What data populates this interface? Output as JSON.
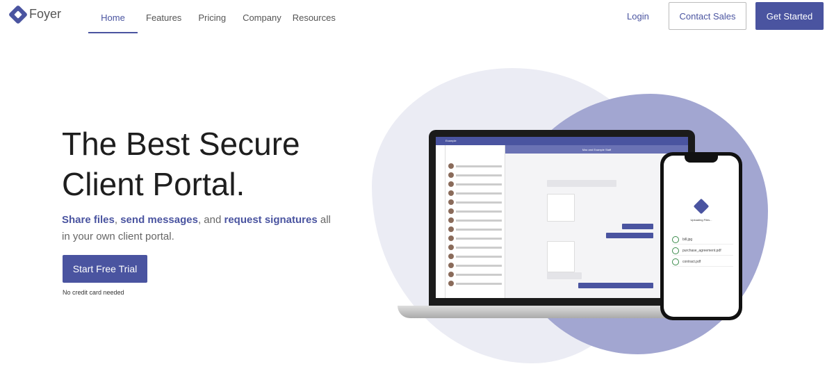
{
  "nav": {
    "logo": "Foyer",
    "links": [
      "Home",
      "Features",
      "Pricing",
      "Company",
      "Resources"
    ],
    "active": "Home",
    "login": "Login",
    "contact_sales": "Contact Sales",
    "get_started": "Get Started"
  },
  "hero": {
    "title_line1": "The Best Secure",
    "title_line2": "Client Portal.",
    "sub": {
      "b1": "Share files",
      "t1": ", ",
      "b2": "send messages",
      "t2": ", and ",
      "b3": "request signatures",
      "t3": " all in your own client portal."
    },
    "cta": "Start Free Trial",
    "note": "No credit card needed"
  },
  "mockup": {
    "app_title": "Example",
    "chat_title": "Max and Example Staff",
    "phone_title": "Uploading Files...",
    "files": [
      "bill.jpg",
      "purchase_agreement.pdf",
      "contract.pdf"
    ]
  },
  "colors": {
    "accent": "#4a54a0",
    "blob_light": "#ebecf4",
    "blob_dark": "#a2a6d1"
  }
}
